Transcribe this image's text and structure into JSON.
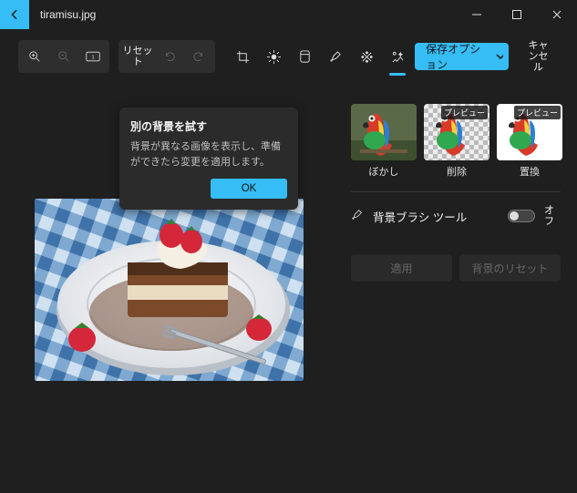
{
  "titlebar": {
    "filename": "tiramisu.jpg"
  },
  "toolbar": {
    "reset_label": "リセット",
    "save_label": "保存オプション",
    "cancel_label": "キャンセル"
  },
  "popup": {
    "title": "別の背景を試す",
    "body": "背景が異なる画像を表示し、準備ができたら変更を適用します。",
    "ok_label": "OK"
  },
  "panel": {
    "thumbs": [
      {
        "label": "ぼかし",
        "badge": ""
      },
      {
        "label": "削除",
        "badge": "プレビュー"
      },
      {
        "label": "置換",
        "badge": "プレビュー"
      }
    ],
    "brush_label": "背景ブラシ ツール",
    "toggle_state": "オフ",
    "apply_label": "適用",
    "reset_bg_label": "背景のリセット"
  }
}
